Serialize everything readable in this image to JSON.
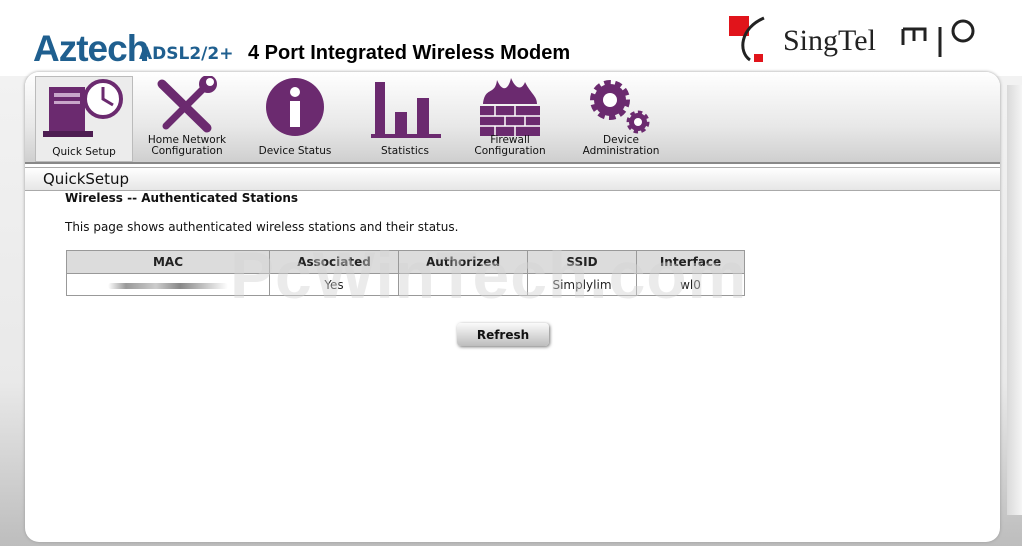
{
  "header": {
    "brand": "Aztech",
    "model": "ADSL2/2+",
    "title": "4 Port Integrated Wireless Modem",
    "operator": "SingTel",
    "colors": {
      "brand_blue": "#1f5f8f",
      "icon_purple": "#6b2a6f",
      "singtel_red": "#e1141b"
    }
  },
  "nav": {
    "items": [
      {
        "label": "Quick Setup",
        "icon": "computer-clock-icon",
        "active": true
      },
      {
        "label": "Home Network Configuration",
        "icon": "tools-icon",
        "active": false
      },
      {
        "label": "Device Status",
        "icon": "info-icon",
        "active": false
      },
      {
        "label": "Statistics",
        "icon": "bar-chart-icon",
        "active": false
      },
      {
        "label": "Firewall Configuration",
        "icon": "firewall-icon",
        "active": false
      },
      {
        "label": "Device Administration",
        "icon": "gears-icon",
        "active": false
      }
    ]
  },
  "section": {
    "breadcrumb": "QuickSetup",
    "heading": "Wireless -- Authenticated Stations",
    "description": "This page shows authenticated wireless stations and their status."
  },
  "table": {
    "headers": [
      "MAC",
      "Associated",
      "Authorized",
      "SSID",
      "Interface"
    ],
    "rows": [
      {
        "mac": "",
        "associated": "Yes",
        "authorized": "",
        "ssid": "Simplylim",
        "interface": "wl0"
      }
    ]
  },
  "watermark": "PcWinTech.com",
  "buttons": {
    "refresh": "Refresh"
  }
}
